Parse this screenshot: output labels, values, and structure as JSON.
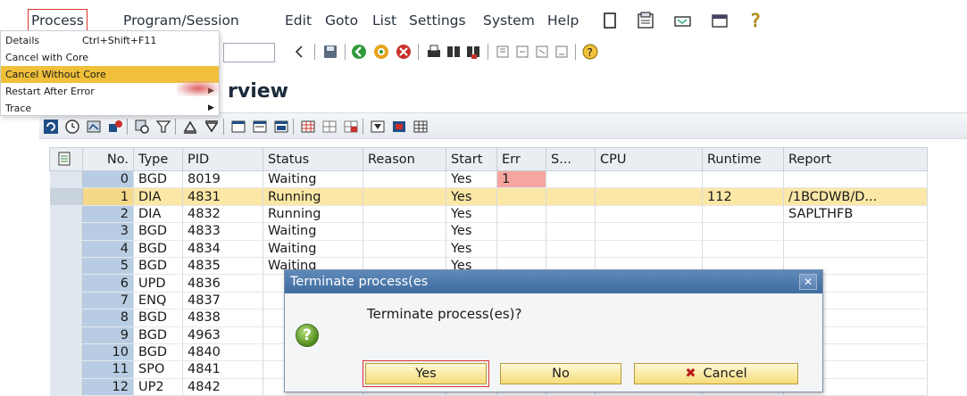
{
  "menubar": {
    "items": [
      "Process",
      "Program/Session",
      "Edit",
      "Goto",
      "List",
      "Settings",
      "System",
      "Help"
    ]
  },
  "process_menu": {
    "items": [
      {
        "label": "Details",
        "shortcut": "Ctrl+Shift+F11"
      },
      {
        "label": "Cancel with Core",
        "shortcut": ""
      },
      {
        "label": "Cancel Without Core",
        "shortcut": ""
      },
      {
        "label": "Restart After Error",
        "shortcut": ""
      },
      {
        "label": "Trace",
        "shortcut": ""
      }
    ],
    "highlighted": "Cancel Without Core"
  },
  "page": {
    "title": "rview"
  },
  "table": {
    "headers": [
      "No.",
      "Type",
      "PID",
      "Status",
      "Reason",
      "Start",
      "Err",
      "S...",
      "CPU",
      "Runtime",
      "Report"
    ],
    "rows": [
      {
        "no": "0",
        "type": "BGD",
        "pid": "8019",
        "status": "Waiting",
        "reason": "",
        "start": "Yes",
        "err": "1",
        "sem": "",
        "cpu": "",
        "runtime": "",
        "report": ""
      },
      {
        "no": "1",
        "type": "DIA",
        "pid": "4831",
        "status": "Running",
        "reason": "",
        "start": "Yes",
        "err": "",
        "sem": "",
        "cpu": "",
        "runtime": "112",
        "report": "/1BCDWB/D..."
      },
      {
        "no": "2",
        "type": "DIA",
        "pid": "4832",
        "status": "Running",
        "reason": "",
        "start": "Yes",
        "err": "",
        "sem": "",
        "cpu": "",
        "runtime": "",
        "report": "SAPLTHFB"
      },
      {
        "no": "3",
        "type": "BGD",
        "pid": "4833",
        "status": "Waiting",
        "reason": "",
        "start": "Yes",
        "err": "",
        "sem": "",
        "cpu": "",
        "runtime": "",
        "report": ""
      },
      {
        "no": "4",
        "type": "BGD",
        "pid": "4834",
        "status": "Waiting",
        "reason": "",
        "start": "Yes",
        "err": "",
        "sem": "",
        "cpu": "",
        "runtime": "",
        "report": ""
      },
      {
        "no": "5",
        "type": "BGD",
        "pid": "4835",
        "status": "Waiting",
        "reason": "",
        "start": "Yes",
        "err": "",
        "sem": "",
        "cpu": "",
        "runtime": "",
        "report": ""
      },
      {
        "no": "6",
        "type": "UPD",
        "pid": "4836",
        "status": "",
        "reason": "",
        "start": "",
        "err": "",
        "sem": "",
        "cpu": "",
        "runtime": "",
        "report": ""
      },
      {
        "no": "7",
        "type": "ENQ",
        "pid": "4837",
        "status": "",
        "reason": "",
        "start": "",
        "err": "",
        "sem": "",
        "cpu": "",
        "runtime": "",
        "report": ""
      },
      {
        "no": "8",
        "type": "BGD",
        "pid": "4838",
        "status": "",
        "reason": "",
        "start": "",
        "err": "",
        "sem": "",
        "cpu": "",
        "runtime": "",
        "report": ""
      },
      {
        "no": "9",
        "type": "BGD",
        "pid": "4963",
        "status": "",
        "reason": "",
        "start": "",
        "err": "",
        "sem": "",
        "cpu": "",
        "runtime": "",
        "report": ""
      },
      {
        "no": "10",
        "type": "BGD",
        "pid": "4840",
        "status": "",
        "reason": "",
        "start": "",
        "err": "",
        "sem": "",
        "cpu": "",
        "runtime": "",
        "report": ""
      },
      {
        "no": "11",
        "type": "SPO",
        "pid": "4841",
        "status": "",
        "reason": "",
        "start": "",
        "err": "",
        "sem": "",
        "cpu": "",
        "runtime": "",
        "report": ""
      },
      {
        "no": "12",
        "type": "UP2",
        "pid": "4842",
        "status": "",
        "reason": "",
        "start": "",
        "err": "",
        "sem": "",
        "cpu": "",
        "runtime": "",
        "report": ""
      }
    ],
    "highlighted_row": "1",
    "error_row": "0"
  },
  "dialog": {
    "title": "Terminate process(es",
    "message": "Terminate process(es)?",
    "buttons": {
      "yes": "Yes",
      "no": "No",
      "cancel": "Cancel"
    }
  },
  "colors": {
    "menu_highlight": "#f0c03a",
    "row_highlight": "#fbe7a6",
    "error_cell": "#f6a6a0",
    "dialog_title": "#4a77aa"
  }
}
